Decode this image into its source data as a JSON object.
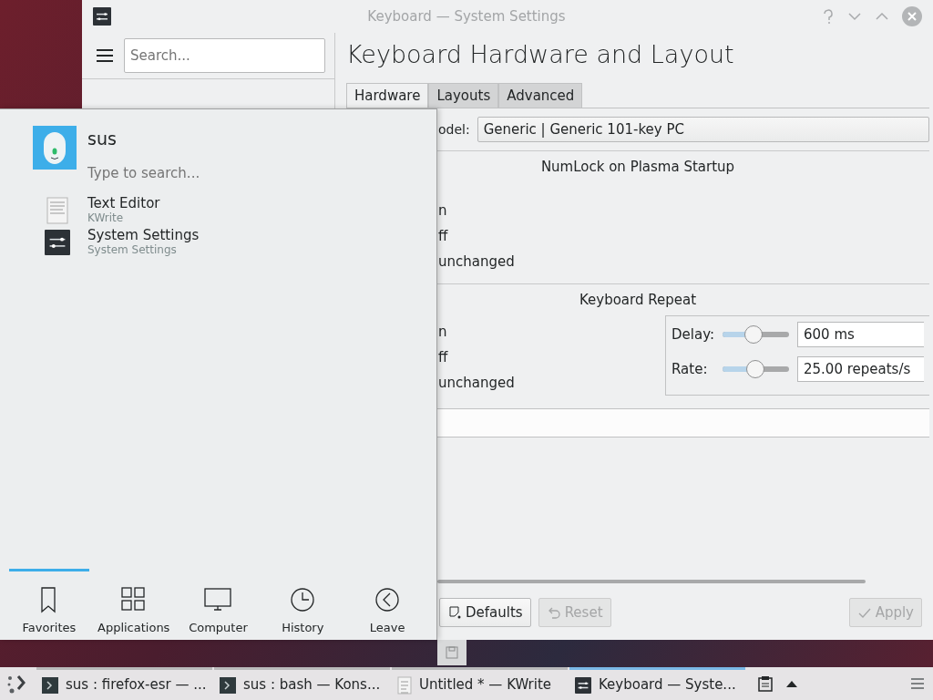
{
  "settings_window": {
    "title": "Keyboard — System Settings",
    "search": {
      "placeholder": "Search..."
    },
    "heading": "Keyboard Hardware and Layout",
    "tabs": [
      {
        "label": "Hardware",
        "selected": true
      },
      {
        "label": "Layouts",
        "selected": false
      },
      {
        "label": "Advanced",
        "selected": false
      }
    ],
    "model_label": "odel:",
    "model_value": "Generic | Generic 101-key PC",
    "groups": [
      {
        "title": "NumLock on Plasma Startup",
        "options": [
          "n",
          "ff",
          "unchanged"
        ]
      },
      {
        "title": "Keyboard Repeat",
        "options": [
          "n",
          "ff",
          "unchanged"
        ],
        "settings": [
          {
            "label": "Delay:",
            "level": 0.47,
            "value": "600 ms"
          },
          {
            "label": "Rate:",
            "level": 0.49,
            "value": "25.00 repeats/s"
          }
        ]
      }
    ],
    "buttons": [
      {
        "label": "Defaults",
        "kind": "defaults",
        "disabled": false
      },
      {
        "label": "Reset",
        "kind": "reset",
        "disabled": true
      },
      {
        "label": "Apply",
        "kind": "apply",
        "disabled": true
      }
    ]
  },
  "launcher": {
    "user": "sus",
    "search": {
      "placeholder": "Type to search..."
    },
    "items": [
      {
        "name": "Text Editor",
        "subtitle": "KWrite",
        "kind": "document"
      },
      {
        "name": "System Settings",
        "subtitle": "System Settings",
        "kind": "settings"
      }
    ],
    "tabs": [
      {
        "label": "Favorites",
        "kind": "favorites",
        "selected": true
      },
      {
        "label": "Applications",
        "kind": "applications",
        "selected": false
      },
      {
        "label": "Computer",
        "kind": "computer",
        "selected": false
      },
      {
        "label": "History",
        "kind": "history",
        "selected": false
      },
      {
        "label": "Leave",
        "kind": "leave",
        "selected": false
      }
    ]
  },
  "taskbar": {
    "tasks": [
      {
        "label": "sus : firefox-esr — ...",
        "kind": "terminal",
        "selected": false
      },
      {
        "label": "sus : bash — Kons...",
        "kind": "terminal",
        "selected": false
      },
      {
        "label": "Untitled * — KWrite",
        "kind": "document",
        "selected": false
      },
      {
        "label": "Keyboard  — Syste...",
        "kind": "settings",
        "selected": true
      }
    ]
  }
}
